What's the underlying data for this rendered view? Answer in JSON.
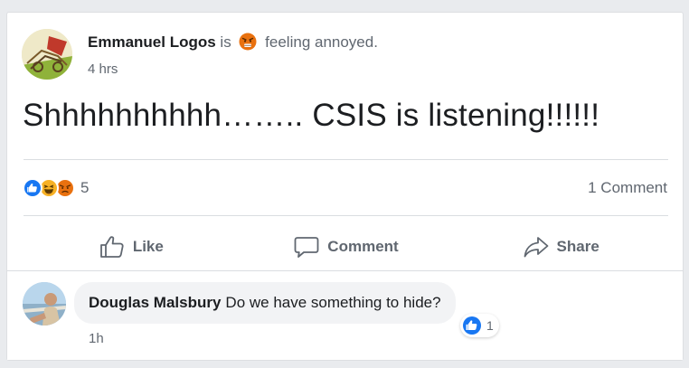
{
  "post": {
    "author": "Emmanuel Logos",
    "is_word": "is",
    "feeling": "feeling annoyed.",
    "time": "4 hrs",
    "text": "Shhhhhhhhhh…….. CSIS is listening!!!!!!",
    "reaction_count": "5",
    "comments_count": "1 Comment",
    "reaction_icons": [
      "like-icon",
      "haha-icon",
      "angry-icon"
    ]
  },
  "actions": {
    "like": "Like",
    "comment": "Comment",
    "share": "Share"
  },
  "comment": {
    "author": "Douglas Malsbury",
    "text": "Do we have something to hide?",
    "time": "1h",
    "like_count": "1"
  },
  "colors": {
    "like_blue": "#1877f2",
    "angry_orange": "#e9710f",
    "haha_yellow": "#f7b125",
    "text_muted": "#606770"
  }
}
